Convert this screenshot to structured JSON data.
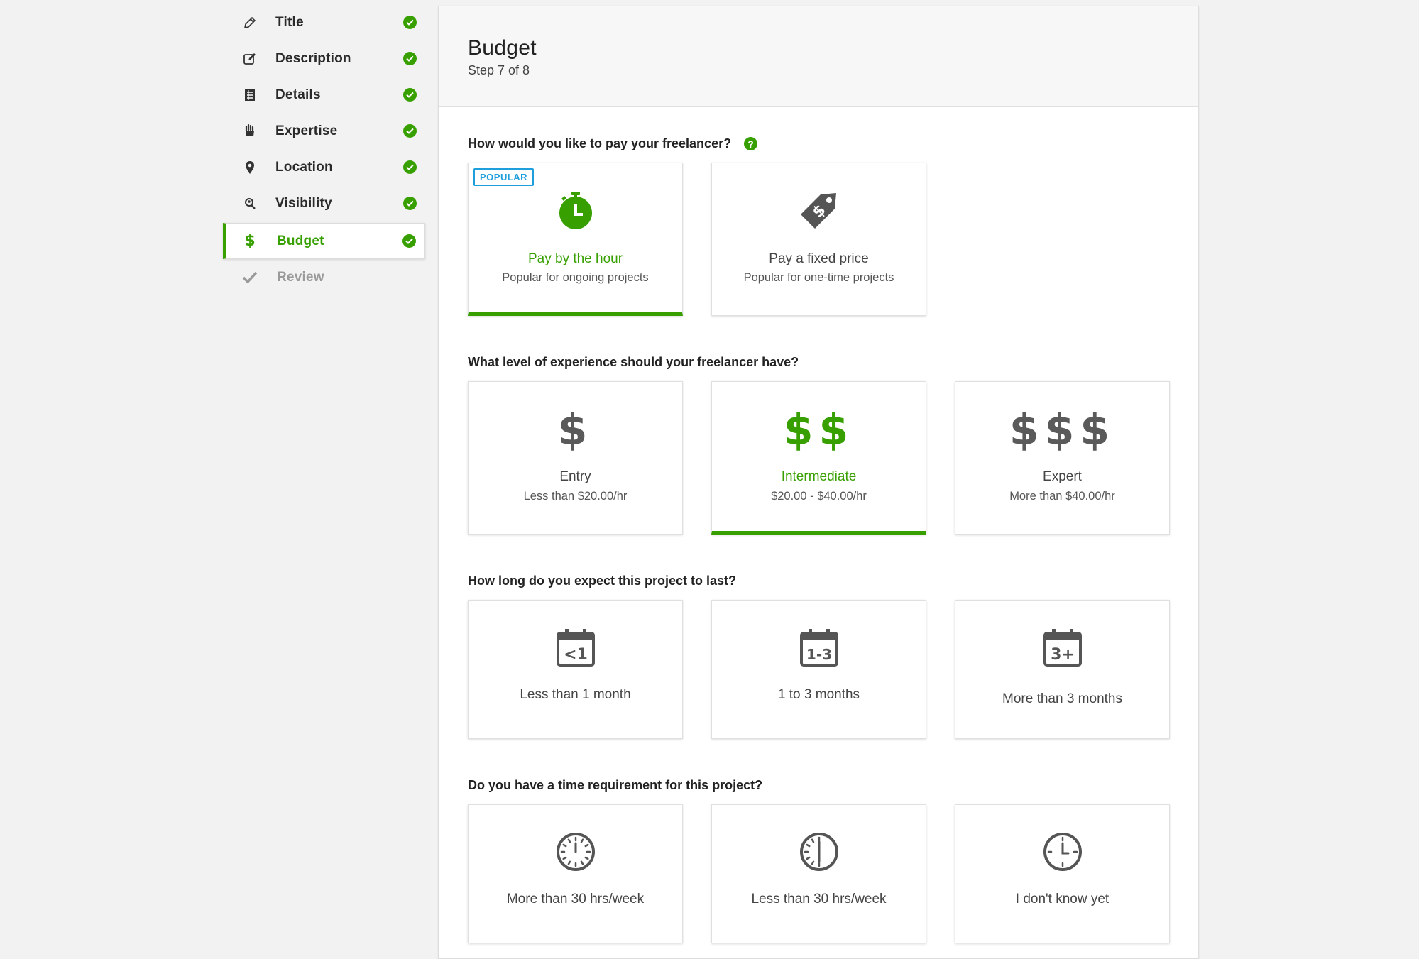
{
  "sidebar": {
    "items": [
      {
        "label": "Title",
        "icon": "pencil-icon",
        "done": true
      },
      {
        "label": "Description",
        "icon": "edit-icon",
        "done": true
      },
      {
        "label": "Details",
        "icon": "list-icon",
        "done": true
      },
      {
        "label": "Expertise",
        "icon": "hand-icon",
        "done": true
      },
      {
        "label": "Location",
        "icon": "map-pin-icon",
        "done": true
      },
      {
        "label": "Visibility",
        "icon": "user-search-icon",
        "done": true
      },
      {
        "label": "Budget",
        "icon": "dollar-icon",
        "done": true,
        "active": true
      },
      {
        "label": "Review",
        "icon": "checkmark-icon",
        "done": false,
        "disabled": true
      }
    ]
  },
  "header": {
    "title": "Budget",
    "step": "Step 7 of 8"
  },
  "payment": {
    "question": "How would you like to pay your freelancer?",
    "options": [
      {
        "title": "Pay by the hour",
        "subtitle": "Popular for ongoing projects",
        "badge": "POPULAR",
        "selected": true,
        "icon": "stopwatch-icon"
      },
      {
        "title": "Pay a fixed price",
        "subtitle": "Popular for one-time projects",
        "selected": false,
        "icon": "price-tag-icon"
      }
    ]
  },
  "experience": {
    "question": "What level of experience should your freelancer have?",
    "options": [
      {
        "symbol": "$",
        "title": "Entry",
        "subtitle": "Less than $20.00/hr",
        "selected": false
      },
      {
        "symbol": "$$",
        "title": "Intermediate",
        "subtitle": "$20.00 - $40.00/hr",
        "selected": true
      },
      {
        "symbol": "$$$",
        "title": "Expert",
        "subtitle": "More than $40.00/hr",
        "selected": false
      }
    ]
  },
  "duration": {
    "question": "How long do you expect this project to last?",
    "options": [
      {
        "icon_text": "<1",
        "title": "Less than 1 month"
      },
      {
        "icon_text": "1-3",
        "title": "1 to 3 months"
      },
      {
        "icon_text": "3+",
        "title": "More than 3 months"
      }
    ]
  },
  "time_requirement": {
    "question": "Do you have a time requirement for this project?",
    "options": [
      {
        "title": "More than 30 hrs/week",
        "icon": "clock-full-icon"
      },
      {
        "title": "Less than 30 hrs/week",
        "icon": "clock-half-icon"
      },
      {
        "title": "I don't know yet",
        "icon": "clock-icon"
      }
    ]
  },
  "colors": {
    "accent": "#37a000",
    "badge": "#1e9fdc",
    "icon_gray": "#5a5a5a"
  }
}
